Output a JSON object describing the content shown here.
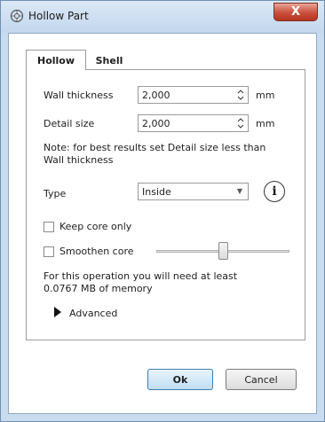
{
  "window": {
    "title": "Hollow Part",
    "close_label": "X"
  },
  "tabs": [
    {
      "label": "Hollow"
    },
    {
      "label": "Shell"
    }
  ],
  "wall_thickness": {
    "label": "Wall thickness",
    "value": "2,000",
    "unit": "mm"
  },
  "detail_size": {
    "label": "Detail size",
    "value": "2,000",
    "unit": "mm"
  },
  "note": {
    "line1": "Note: for best results set Detail size less than",
    "line2": "Wall thickness"
  },
  "type": {
    "label": "Type",
    "value": "Inside",
    "info_label": "i"
  },
  "keep_core": {
    "label": "Keep core only",
    "checked": false
  },
  "smoothen_core": {
    "label": "Smoothen core",
    "checked": false,
    "slider_fraction": 0.5
  },
  "memory": {
    "line1": "For this operation you will need at least",
    "line2": "0.0767 MB of memory"
  },
  "advanced": {
    "label": "Advanced"
  },
  "buttons": {
    "ok": "Ok",
    "cancel": "Cancel"
  }
}
